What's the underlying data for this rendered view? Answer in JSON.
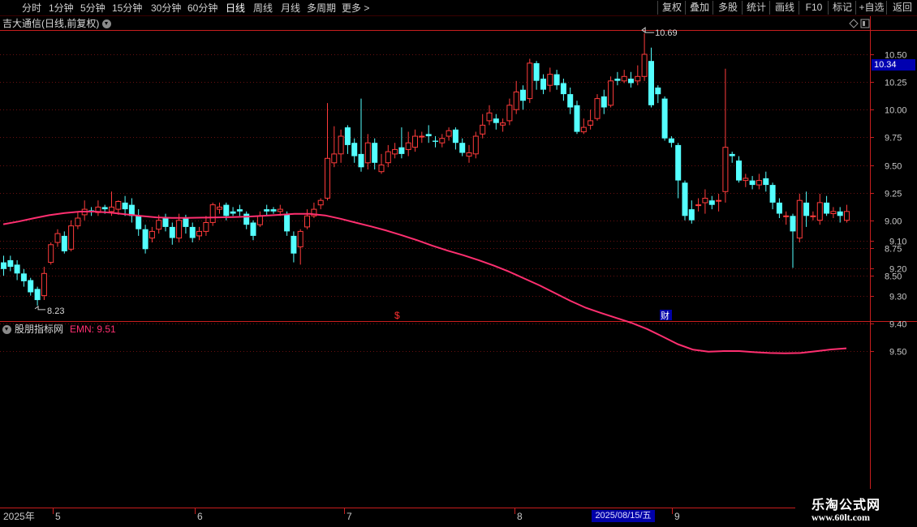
{
  "period_tabs": [
    {
      "label": "分时",
      "active": false
    },
    {
      "label": "1分钟",
      "active": false
    },
    {
      "label": "5分钟",
      "active": false
    },
    {
      "label": "15分钟",
      "active": false
    },
    {
      "label": "30分钟",
      "active": false
    },
    {
      "label": "60分钟",
      "active": false
    },
    {
      "label": "日线",
      "active": true
    },
    {
      "label": "周线",
      "active": false
    },
    {
      "label": "月线",
      "active": false
    },
    {
      "label": "多周期",
      "active": false
    },
    {
      "label": "更多 >",
      "active": false
    }
  ],
  "right_buttons": [
    "复权",
    "叠加",
    "多股",
    "统计",
    "画线",
    "F10",
    "标记",
    "+自选",
    "返回"
  ],
  "main_title": "吉大通信(日线,前复权)",
  "current_price": "10.34",
  "indicator": {
    "name": "股朋指标网",
    "label": "EMN: 9.51"
  },
  "markers": {
    "high_label": "10.69",
    "low_label": "8.23",
    "event_s": "$",
    "event_cai": "财"
  },
  "x_axis": {
    "year_label": "2025年",
    "month_labels": [
      "5",
      "6",
      "7",
      "8",
      "9"
    ],
    "highlight_date": "2025/08/15/五"
  },
  "watermark": {
    "line1": "乐淘公式网",
    "line2": "www.60lt.com"
  },
  "colors": {
    "up": "#ff3b3b",
    "down": "#54ffff",
    "indicator_line": "#ff2f70",
    "axis": "#c81e1e",
    "grid": "#6a1010",
    "background": "#000000"
  },
  "chart_data": [
    {
      "type": "candlestick",
      "ylim": [
        8.2,
        10.65
      ],
      "yticks": [
        8.5,
        8.75,
        9.0,
        9.25,
        9.5,
        9.75,
        10.0,
        10.25,
        10.5
      ],
      "high": 10.69,
      "low": 8.23,
      "candles": [
        [
          8.62,
          8.56,
          8.68,
          8.5
        ],
        [
          8.64,
          8.58,
          8.68,
          8.54
        ],
        [
          8.6,
          8.52,
          8.64,
          8.46
        ],
        [
          8.52,
          8.45,
          8.56,
          8.4
        ],
        [
          8.46,
          8.35,
          8.48,
          8.32
        ],
        [
          8.38,
          8.28,
          8.4,
          8.23
        ],
        [
          8.32,
          8.52,
          8.58,
          8.28
        ],
        [
          8.62,
          8.78,
          8.8,
          8.6
        ],
        [
          8.8,
          8.88,
          8.92,
          8.76
        ],
        [
          8.86,
          8.72,
          8.9,
          8.7
        ],
        [
          8.74,
          8.95,
          9.0,
          8.72
        ],
        [
          8.95,
          9.02,
          9.08,
          8.92
        ],
        [
          9.05,
          9.1,
          9.18,
          9.0
        ],
        [
          9.09,
          9.08,
          9.12,
          9.04
        ],
        [
          9.07,
          9.12,
          9.18,
          9.04
        ],
        [
          9.12,
          9.1,
          9.14,
          9.06
        ],
        [
          9.08,
          9.12,
          9.26,
          9.04
        ],
        [
          9.1,
          9.17,
          9.18,
          9.05
        ],
        [
          9.16,
          9.1,
          9.22,
          9.04
        ],
        [
          9.14,
          9.04,
          9.2,
          8.98
        ],
        [
          9.04,
          8.92,
          9.1,
          8.86
        ],
        [
          8.92,
          8.74,
          8.96,
          8.7
        ],
        [
          8.84,
          8.9,
          8.94,
          8.8
        ],
        [
          8.92,
          9.0,
          9.05,
          8.88
        ],
        [
          9.02,
          8.94,
          9.06,
          8.9
        ],
        [
          8.94,
          8.84,
          8.98,
          8.78
        ],
        [
          8.84,
          9.0,
          9.06,
          8.8
        ],
        [
          9.02,
          8.94,
          9.05,
          8.88
        ],
        [
          8.94,
          8.84,
          8.98,
          8.8
        ],
        [
          8.86,
          8.9,
          8.94,
          8.82
        ],
        [
          8.9,
          8.98,
          9.04,
          8.86
        ],
        [
          8.98,
          9.14,
          9.16,
          8.95
        ],
        [
          9.1,
          9.12,
          9.16,
          9.06
        ],
        [
          9.14,
          9.04,
          9.16,
          9.0
        ],
        [
          9.08,
          9.06,
          9.12,
          9.04
        ],
        [
          9.1,
          9.08,
          9.14,
          9.04
        ],
        [
          9.06,
          8.96,
          9.08,
          8.92
        ],
        [
          8.98,
          8.86,
          9.0,
          8.82
        ],
        [
          8.96,
          9.04,
          9.08,
          8.94
        ],
        [
          9.1,
          9.08,
          9.14,
          9.04
        ],
        [
          9.1,
          9.08,
          9.12,
          9.06
        ],
        [
          9.08,
          9.1,
          9.14,
          9.04
        ],
        [
          9.06,
          8.9,
          9.08,
          8.86
        ],
        [
          8.86,
          8.7,
          8.9,
          8.62
        ],
        [
          8.76,
          8.9,
          8.92,
          8.6
        ],
        [
          8.94,
          9.04,
          9.1,
          8.92
        ],
        [
          9.04,
          9.1,
          9.16,
          9.02
        ],
        [
          9.14,
          9.18,
          9.2,
          9.1
        ],
        [
          9.2,
          9.56,
          10.06,
          9.18
        ],
        [
          9.52,
          9.6,
          9.85,
          9.48
        ],
        [
          9.6,
          9.76,
          9.82,
          9.52
        ],
        [
          9.84,
          9.68,
          9.86,
          9.6
        ],
        [
          9.7,
          9.58,
          9.74,
          9.52
        ],
        [
          9.6,
          9.48,
          10.1,
          9.44
        ],
        [
          9.52,
          9.7,
          9.78,
          9.46
        ],
        [
          9.7,
          9.52,
          9.74,
          9.46
        ],
        [
          9.44,
          9.5,
          9.6,
          9.42
        ],
        [
          9.52,
          9.62,
          9.68,
          9.48
        ],
        [
          9.6,
          9.64,
          9.7,
          9.56
        ],
        [
          9.66,
          9.6,
          9.84,
          9.56
        ],
        [
          9.64,
          9.7,
          9.8,
          9.58
        ],
        [
          9.66,
          9.76,
          9.82,
          9.62
        ],
        [
          9.76,
          9.76,
          9.8,
          9.7
        ],
        [
          9.78,
          9.76,
          9.86,
          9.7
        ],
        [
          9.72,
          9.71,
          9.76,
          9.66
        ],
        [
          9.7,
          9.74,
          9.78,
          9.66
        ],
        [
          9.76,
          9.81,
          9.84,
          9.72
        ],
        [
          9.82,
          9.7,
          9.84,
          9.64
        ],
        [
          9.7,
          9.61,
          9.74,
          9.58
        ],
        [
          9.58,
          9.61,
          9.68,
          9.52
        ],
        [
          9.6,
          9.76,
          9.8,
          9.56
        ],
        [
          9.78,
          9.86,
          9.96,
          9.74
        ],
        [
          9.9,
          9.97,
          10.04,
          9.86
        ],
        [
          9.92,
          9.88,
          9.96,
          9.82
        ],
        [
          9.86,
          9.88,
          9.92,
          9.8
        ],
        [
          9.9,
          10.04,
          10.1,
          9.86
        ],
        [
          10.0,
          10.16,
          10.26,
          9.96
        ],
        [
          10.18,
          10.08,
          10.22,
          10.0
        ],
        [
          10.1,
          10.42,
          10.46,
          10.06
        ],
        [
          10.42,
          10.26,
          10.44,
          10.18
        ],
        [
          10.28,
          10.18,
          10.32,
          10.14
        ],
        [
          10.22,
          10.32,
          10.38,
          10.16
        ],
        [
          10.32,
          10.22,
          10.36,
          10.18
        ],
        [
          10.24,
          10.14,
          10.28,
          10.08
        ],
        [
          10.14,
          10.02,
          10.2,
          9.96
        ],
        [
          10.04,
          9.8,
          10.08,
          9.78
        ],
        [
          9.8,
          9.84,
          9.92,
          9.78
        ],
        [
          9.86,
          9.9,
          10.0,
          9.82
        ],
        [
          9.92,
          10.1,
          10.14,
          9.9
        ],
        [
          10.12,
          10.02,
          10.18,
          9.96
        ],
        [
          10.04,
          10.26,
          10.3,
          10.02
        ],
        [
          10.28,
          10.26,
          10.34,
          10.22
        ],
        [
          10.26,
          10.3,
          10.36,
          10.24
        ],
        [
          10.28,
          10.24,
          10.34,
          10.2
        ],
        [
          10.26,
          10.3,
          10.4,
          10.22
        ],
        [
          10.3,
          10.5,
          10.69,
          10.26
        ],
        [
          10.44,
          10.04,
          10.56,
          10.02
        ],
        [
          10.2,
          10.14,
          10.22,
          10.06
        ],
        [
          10.1,
          9.74,
          10.12,
          9.72
        ],
        [
          9.74,
          9.7,
          9.76,
          9.66
        ],
        [
          9.68,
          9.36,
          9.7,
          9.2
        ],
        [
          9.34,
          9.04,
          9.36,
          9.0
        ],
        [
          9.1,
          9.0,
          9.18,
          8.97
        ],
        [
          9.14,
          9.14,
          9.2,
          9.08
        ],
        [
          9.16,
          9.2,
          9.28,
          9.06
        ],
        [
          9.18,
          9.14,
          9.22,
          9.1
        ],
        [
          9.18,
          9.18,
          9.24,
          9.08
        ],
        [
          9.26,
          9.66,
          10.37,
          9.16
        ],
        [
          9.6,
          9.58,
          9.62,
          9.52
        ],
        [
          9.54,
          9.36,
          9.58,
          9.34
        ],
        [
          9.36,
          9.38,
          9.42,
          9.3
        ],
        [
          9.36,
          9.32,
          9.4,
          9.28
        ],
        [
          9.32,
          9.36,
          9.42,
          9.28
        ],
        [
          9.38,
          9.32,
          9.44,
          9.26
        ],
        [
          9.32,
          9.16,
          9.34,
          9.1
        ],
        [
          9.16,
          9.06,
          9.2,
          9.02
        ],
        [
          9.04,
          9.04,
          9.08,
          8.96
        ],
        [
          9.04,
          8.9,
          9.06,
          8.57
        ],
        [
          8.84,
          9.18,
          9.24,
          8.8
        ],
        [
          9.16,
          9.04,
          9.26,
          8.94
        ],
        [
          9.04,
          9.04,
          9.08,
          9.0
        ],
        [
          9.0,
          9.16,
          9.24,
          8.96
        ],
        [
          9.16,
          9.06,
          9.22,
          9.04
        ],
        [
          9.06,
          9.08,
          9.12,
          9.02
        ],
        [
          9.08,
          9.04,
          9.12,
          8.98
        ],
        [
          9.0,
          9.08,
          9.14,
          8.98
        ]
      ]
    },
    {
      "type": "line",
      "series": [
        {
          "name": "EMN"
        }
      ],
      "ylim": [
        8.98,
        9.62
      ],
      "yticks": [
        9.1,
        9.2,
        9.3,
        9.4,
        9.5
      ],
      "values": [
        9.04,
        9.03,
        9.018,
        9.007,
        8.999,
        8.994,
        8.994,
        8.998,
        9.004,
        9.01,
        9.015,
        9.017,
        9.017,
        9.016,
        9.015,
        9.014,
        9.012,
        9.009,
        9.006,
        9.002,
        9.002,
        9.008,
        9.02,
        9.034,
        9.048,
        9.063,
        9.08,
        9.098,
        9.118,
        9.136,
        9.152,
        9.17,
        9.19,
        9.212,
        9.237,
        9.262,
        9.29,
        9.318,
        9.343,
        9.362,
        9.38,
        9.398,
        9.42,
        9.447,
        9.475,
        9.495,
        9.502,
        9.5,
        9.5,
        9.504,
        9.507,
        9.508,
        9.507,
        9.501,
        9.494,
        9.49
      ]
    }
  ]
}
